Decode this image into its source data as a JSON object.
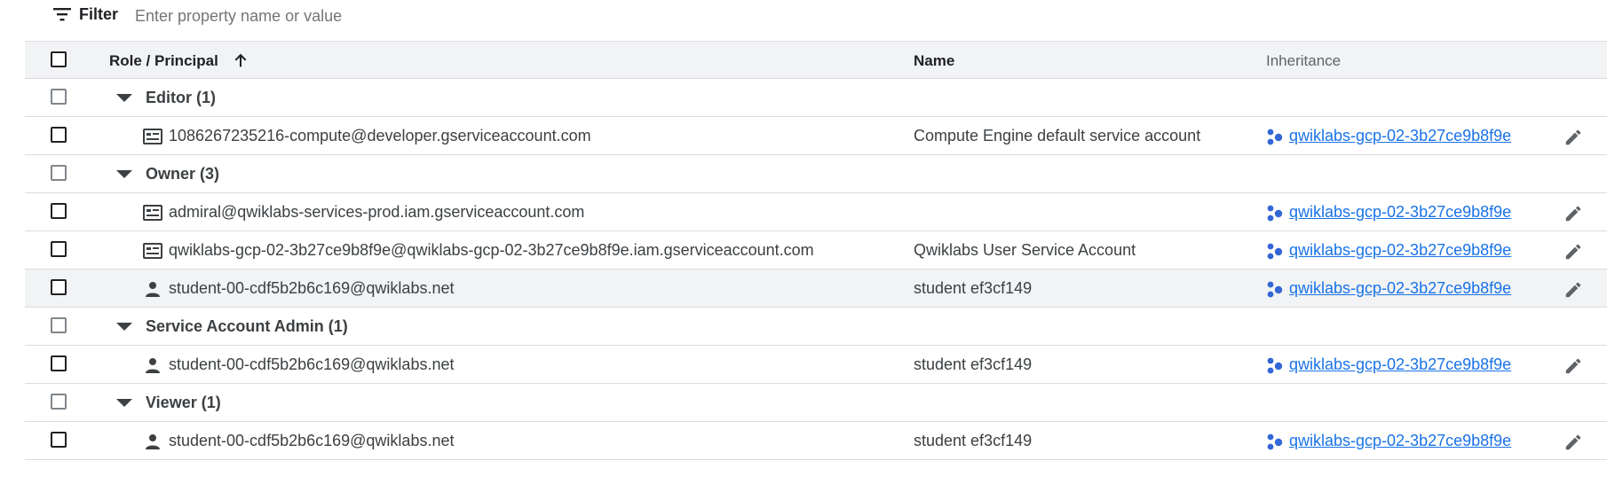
{
  "filter": {
    "label": "Filter",
    "placeholder": "Enter property name or value"
  },
  "columns": {
    "role_principal": "Role / Principal",
    "name": "Name",
    "inheritance": "Inheritance"
  },
  "icons": {
    "filter": "filter-lines-icon",
    "sort": "arrow-up-icon",
    "service_account": "service-account-icon",
    "person": "person-icon",
    "project": "project-nodes-icon",
    "edit": "pencil-icon"
  },
  "colors": {
    "link": "#1a73e8",
    "project_icon": "#3367d6",
    "header_bg": "#f1f3f4"
  },
  "groups": [
    {
      "label": "Editor (1)",
      "members": [
        {
          "principal": "1086267235216-compute@developer.gserviceaccount.com",
          "type": "service_account",
          "name": "Compute Engine default service account",
          "inheritance": "qwiklabs-gcp-02-3b27ce9b8f9e"
        }
      ]
    },
    {
      "label": "Owner (3)",
      "members": [
        {
          "principal": "admiral@qwiklabs-services-prod.iam.gserviceaccount.com",
          "type": "service_account",
          "name": "",
          "inheritance": "qwiklabs-gcp-02-3b27ce9b8f9e"
        },
        {
          "principal": "qwiklabs-gcp-02-3b27ce9b8f9e@qwiklabs-gcp-02-3b27ce9b8f9e.iam.gserviceaccount.com",
          "type": "service_account",
          "name": "Qwiklabs User Service Account",
          "inheritance": "qwiklabs-gcp-02-3b27ce9b8f9e"
        },
        {
          "principal": "student-00-cdf5b2b6c169@qwiklabs.net",
          "type": "person",
          "name": "student ef3cf149",
          "inheritance": "qwiklabs-gcp-02-3b27ce9b8f9e"
        }
      ]
    },
    {
      "label": "Service Account Admin (1)",
      "members": [
        {
          "principal": "student-00-cdf5b2b6c169@qwiklabs.net",
          "type": "person",
          "name": "student ef3cf149",
          "inheritance": "qwiklabs-gcp-02-3b27ce9b8f9e"
        }
      ]
    },
    {
      "label": "Viewer (1)",
      "members": [
        {
          "principal": "student-00-cdf5b2b6c169@qwiklabs.net",
          "type": "person",
          "name": "student ef3cf149",
          "inheritance": "qwiklabs-gcp-02-3b27ce9b8f9e"
        }
      ]
    }
  ]
}
